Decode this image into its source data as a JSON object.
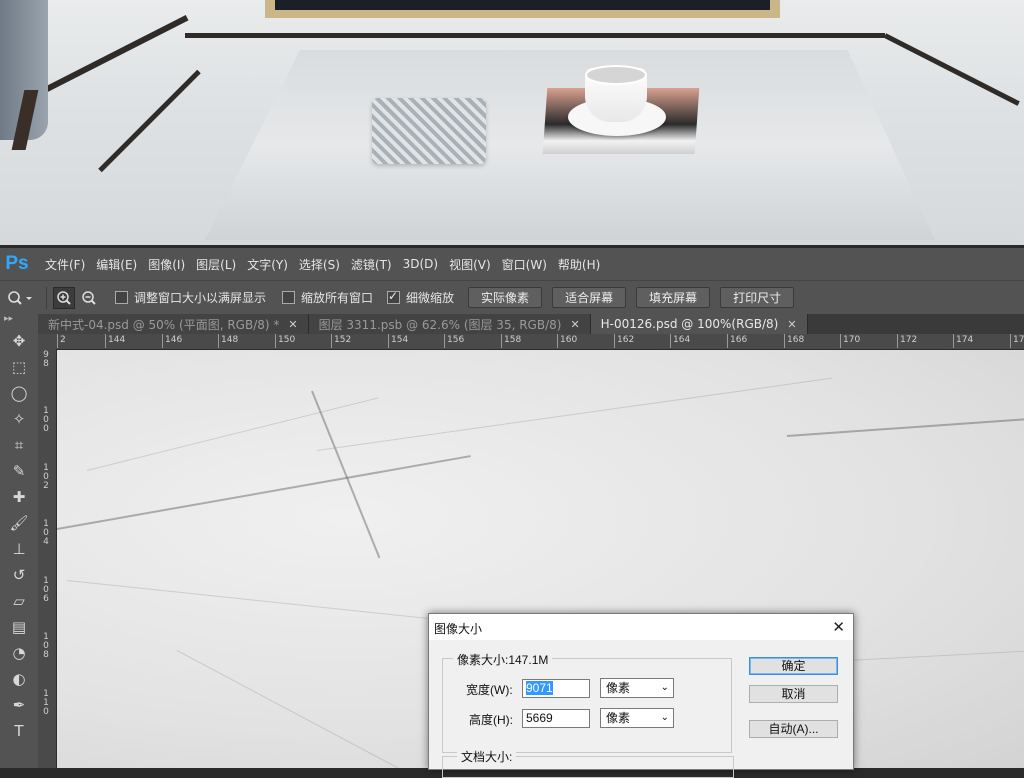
{
  "menubar": {
    "logo": "Ps",
    "items": [
      "文件(F)",
      "编辑(E)",
      "图像(I)",
      "图层(L)",
      "文字(Y)",
      "选择(S)",
      "滤镜(T)",
      "3D(D)",
      "视图(V)",
      "窗口(W)",
      "帮助(H)"
    ]
  },
  "options": {
    "checkbox1": "调整窗口大小以满屏显示",
    "checkbox2": "缩放所有窗口",
    "checkbox3": "细微缩放",
    "checkbox3_checked": true,
    "btn_actual": "实际像素",
    "btn_fit": "适合屏幕",
    "btn_fill": "填充屏幕",
    "btn_print": "打印尺寸"
  },
  "tabs": [
    {
      "label": "新中式-04.psd @ 50% (平面图, RGB/8) *",
      "active": false
    },
    {
      "label": "图层 3311.psb @ 62.6% (图层 35, RGB/8)",
      "active": false
    },
    {
      "label": "H-00126.psd @ 100%(RGB/8)",
      "active": true
    }
  ],
  "ruler": {
    "h": [
      "2",
      "144",
      "146",
      "148",
      "150",
      "152",
      "154",
      "156",
      "158",
      "160",
      "162",
      "164",
      "166",
      "168",
      "170",
      "172",
      "174",
      "17"
    ],
    "v": [
      "9\n8",
      "1\n0\n0",
      "1\n0\n2",
      "1\n0\n4",
      "1\n0\n6",
      "1\n0\n8",
      "1\n1\n0"
    ]
  },
  "dialog": {
    "title": "图像大小",
    "pixel_size": "像素大小:147.1M",
    "width_label": "宽度(W):",
    "width_value": "9071",
    "width_unit": "像素",
    "height_label": "高度(H):",
    "height_value": "5669",
    "height_unit": "像素",
    "doc_size": "文档大小:",
    "ok": "确定",
    "cancel": "取消",
    "auto": "自动(A)..."
  }
}
